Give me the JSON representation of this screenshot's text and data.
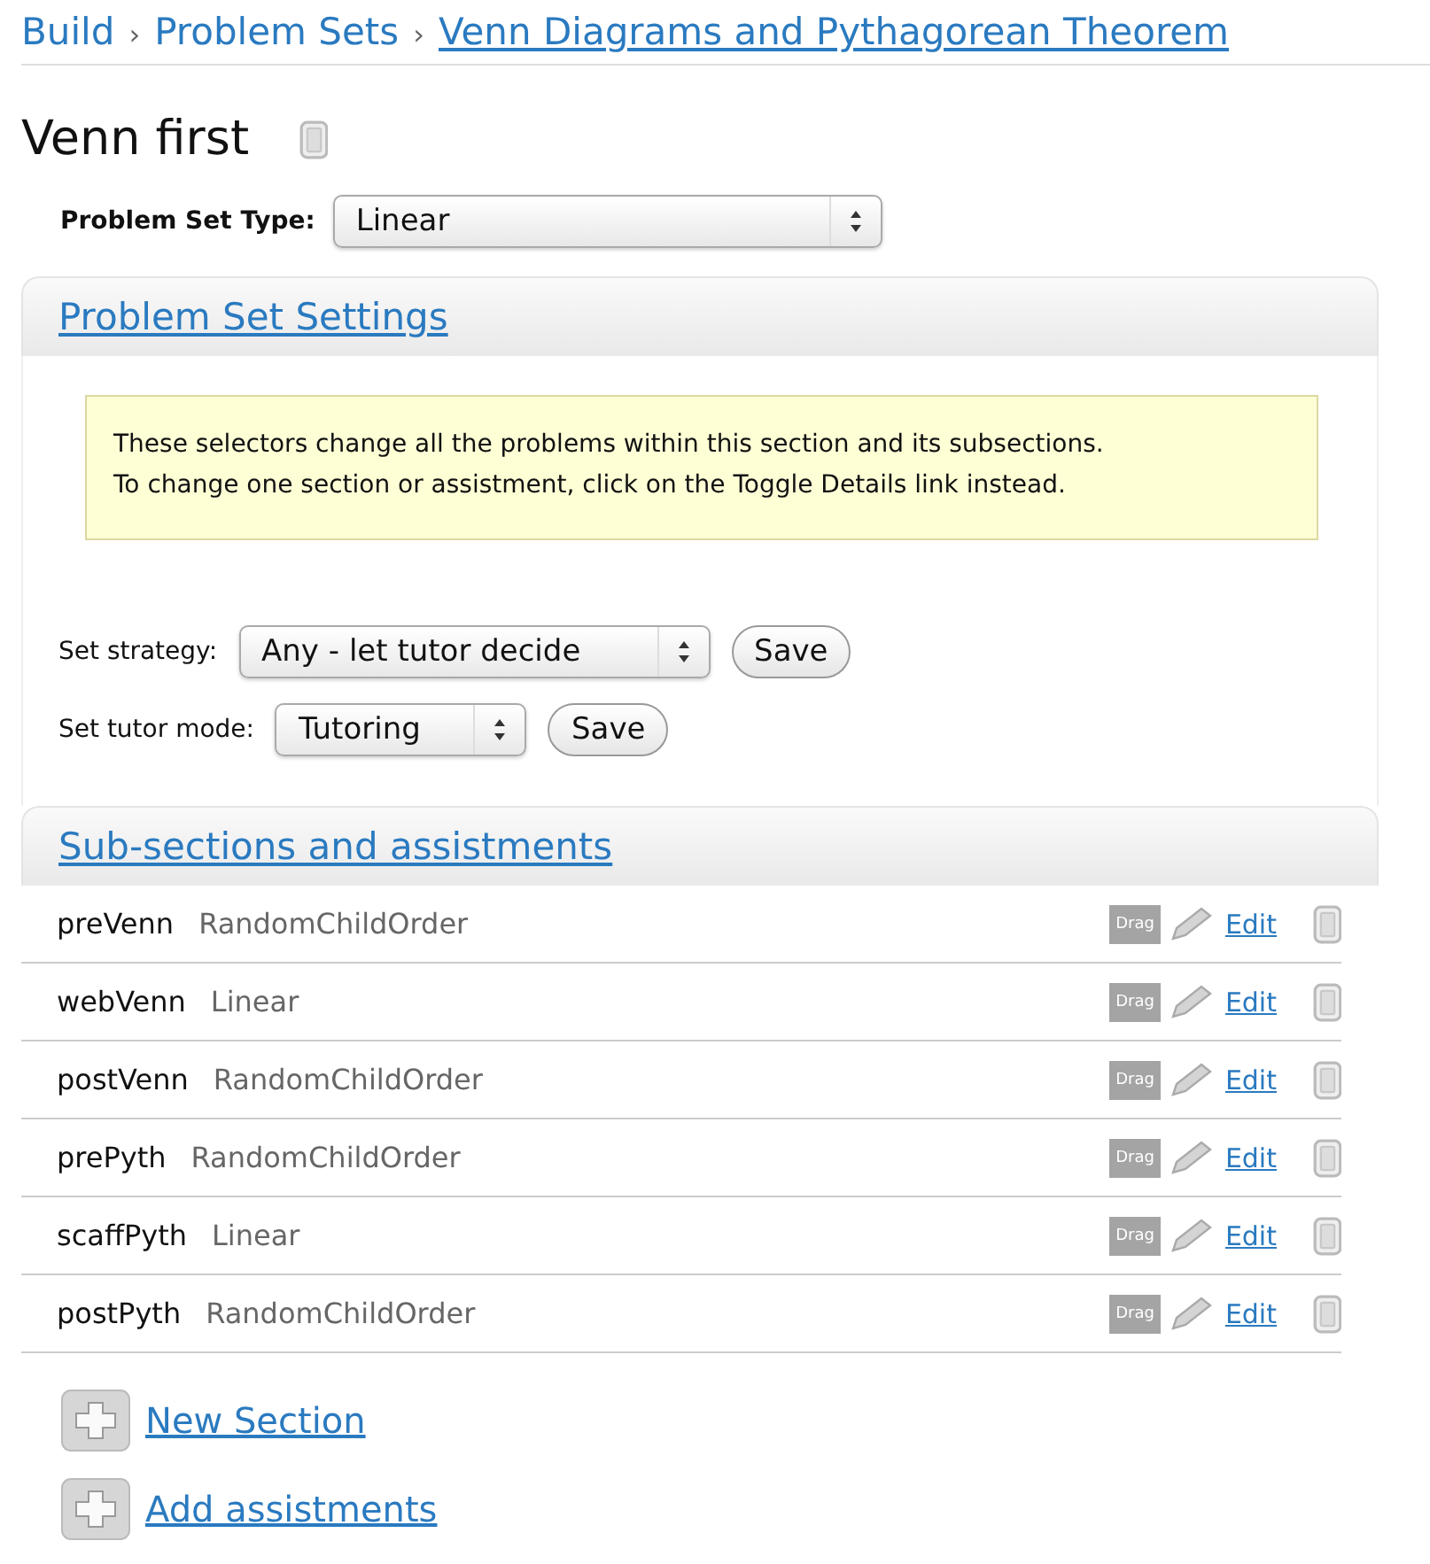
{
  "breadcrumb": {
    "separator": "›",
    "items": [
      {
        "label": "Build",
        "underlined": false
      },
      {
        "label": "Problem Sets",
        "underlined": false
      },
      {
        "label": "Venn Diagrams and Pythagorean Theorem",
        "underlined": true
      }
    ]
  },
  "title": "Venn first",
  "problem_set_type": {
    "label": "Problem Set Type:",
    "value": "Linear"
  },
  "settings": {
    "title": "Problem Set Settings",
    "notice": "These selectors change all the problems within this section and its subsections. To change one section or assistment, click on the Toggle Details link instead.",
    "selectors": [
      {
        "label": "Set strategy:",
        "value": "Any - let tutor decide",
        "button": "Save"
      },
      {
        "label": "Set tutor mode:",
        "value": "Tutoring",
        "button": "Save"
      }
    ]
  },
  "subsections": {
    "title": "Sub-sections and assistments",
    "rows": [
      {
        "name": "preVenn",
        "order": "RandomChildOrder",
        "drag": "Drag",
        "edit": "Edit"
      },
      {
        "name": "webVenn",
        "order": "Linear",
        "drag": "Drag",
        "edit": "Edit"
      },
      {
        "name": "postVenn",
        "order": "RandomChildOrder",
        "drag": "Drag",
        "edit": "Edit"
      },
      {
        "name": "prePyth",
        "order": "RandomChildOrder",
        "drag": "Drag",
        "edit": "Edit"
      },
      {
        "name": "scaffPyth",
        "order": "Linear",
        "drag": "Drag",
        "edit": "Edit"
      },
      {
        "name": "postPyth",
        "order": "RandomChildOrder",
        "drag": "Drag",
        "edit": "Edit"
      }
    ]
  },
  "actions": [
    "New Section",
    "Add assistments"
  ]
}
